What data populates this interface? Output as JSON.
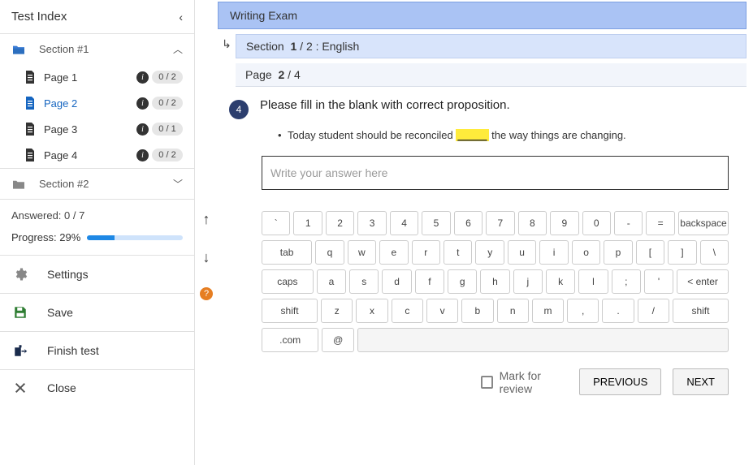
{
  "sidebar": {
    "title": "Test Index",
    "sections": [
      {
        "label": "Section #1",
        "expanded": true
      },
      {
        "label": "Section #2",
        "expanded": false
      }
    ],
    "pages": [
      {
        "label": "Page 1",
        "count": "0 / 2"
      },
      {
        "label": "Page 2",
        "count": "0 / 2"
      },
      {
        "label": "Page 3",
        "count": "0 / 1"
      },
      {
        "label": "Page 4",
        "count": "0 / 2"
      }
    ],
    "answered_label": "Answered: 0 / 7",
    "progress_label": "Progress: 29%",
    "progress_pct": 29,
    "settings_label": "Settings",
    "save_label": "Save",
    "finish_label": "Finish test",
    "close_label": "Close"
  },
  "exam": {
    "title": "Writing Exam",
    "section_prefix": "Section",
    "section_num": "1",
    "section_rest": "/ 2 : English",
    "page_prefix": "Page",
    "page_num": "2",
    "page_rest": "/ 4"
  },
  "question": {
    "number": "4",
    "title": "Please fill in the blank with correct proposition.",
    "text_before": "Today student should be reconciled",
    "blank": "_____",
    "text_after": "the way things are changing.",
    "input_placeholder": "Write your answer here"
  },
  "keyboard": {
    "row1": [
      "`",
      "1",
      "2",
      "3",
      "4",
      "5",
      "6",
      "7",
      "8",
      "9",
      "0",
      "-",
      "=",
      "backspace"
    ],
    "row2": [
      "tab",
      "q",
      "w",
      "e",
      "r",
      "t",
      "y",
      "u",
      "i",
      "o",
      "p",
      "[",
      "]",
      "\\"
    ],
    "row3": [
      "caps",
      "a",
      "s",
      "d",
      "f",
      "g",
      "h",
      "j",
      "k",
      "l",
      ";",
      "'",
      "< enter"
    ],
    "row4": [
      "shift",
      "z",
      "x",
      "c",
      "v",
      "b",
      "n",
      "m",
      ",",
      ".",
      "/",
      "shift"
    ],
    "row5": [
      ".com",
      "@",
      " "
    ]
  },
  "footer": {
    "mark_label": "Mark for review",
    "prev_label": "PREVIOUS",
    "next_label": "NEXT"
  }
}
